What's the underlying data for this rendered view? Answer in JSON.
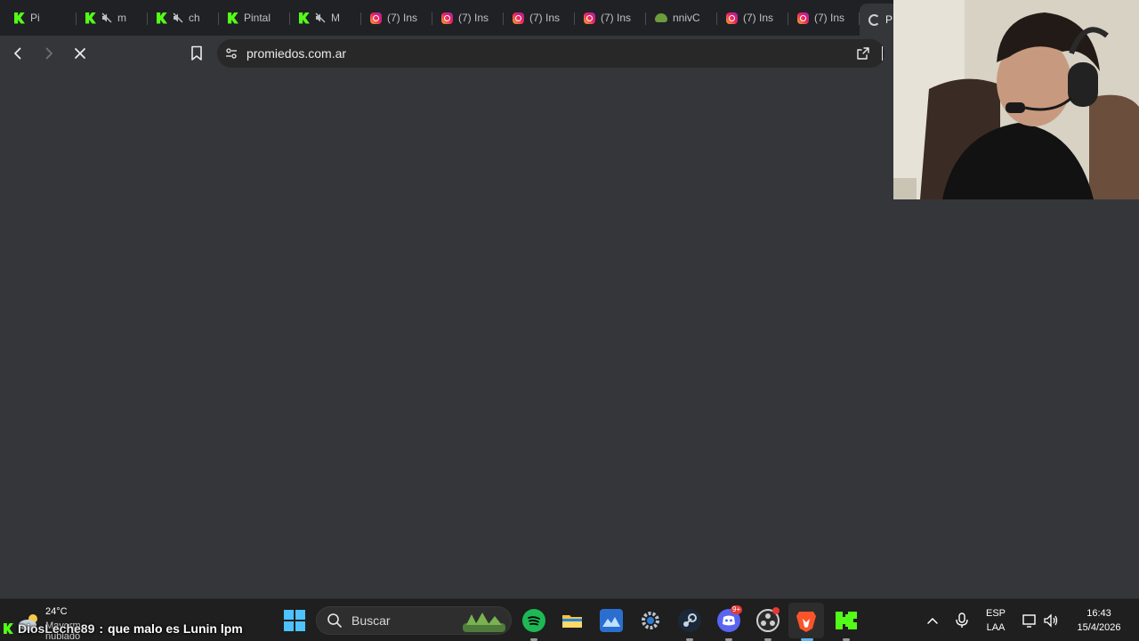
{
  "tabs": [
    {
      "title": "Pi",
      "icon": "kick-icon",
      "muted": false
    },
    {
      "title": "m",
      "icon": "kick-icon",
      "muted": true
    },
    {
      "title": "ch",
      "icon": "kick-icon",
      "muted": true
    },
    {
      "title": "Pintal",
      "icon": "kick-icon",
      "muted": false
    },
    {
      "title": "M",
      "icon": "kick-icon",
      "muted": true
    },
    {
      "title": "(7) Ins",
      "icon": "instagram-icon",
      "muted": false
    },
    {
      "title": "(7) Ins",
      "icon": "instagram-icon",
      "muted": false
    },
    {
      "title": "(7) Ins",
      "icon": "instagram-icon",
      "muted": false
    },
    {
      "title": "(7) Ins",
      "icon": "instagram-icon",
      "muted": false
    },
    {
      "title": "nnivC",
      "icon": "frog-icon",
      "muted": false
    },
    {
      "title": "(7) Ins",
      "icon": "instagram-icon",
      "muted": false
    },
    {
      "title": "(7) Ins",
      "icon": "instagram-icon",
      "muted": false
    },
    {
      "title": "P",
      "icon": "loading-icon",
      "muted": false,
      "active": true
    }
  ],
  "toolbar": {
    "url": "promiedos.com.ar"
  },
  "taskbar": {
    "weather_temp": "24°C",
    "weather_desc": "Mayorm. nublado",
    "search_placeholder": "Buscar",
    "language_top": "ESP",
    "language_bottom": "LAA",
    "time": "16:43",
    "date": "15/4/2026",
    "discord_badge": "9+"
  },
  "chat": {
    "username": "DiosLeche89",
    "separator": ":",
    "message": "que malo es Lunin lpm"
  },
  "colors": {
    "kick_green": "#53fc18",
    "page_bg": "#35363a",
    "tabstrip_bg": "#202124"
  }
}
